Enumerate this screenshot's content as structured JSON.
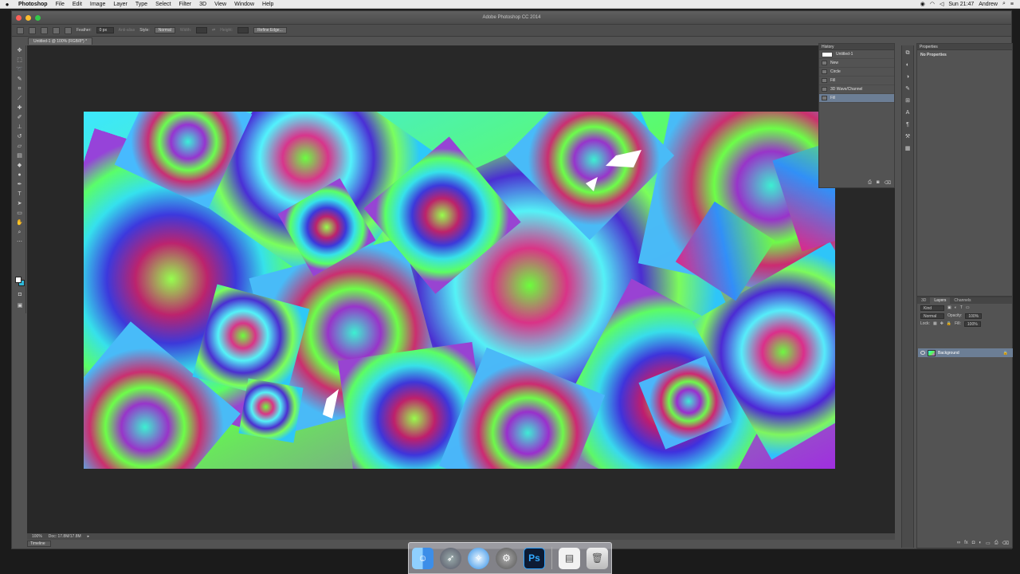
{
  "menubar": {
    "apple": "",
    "app": "Photoshop",
    "items": [
      "File",
      "Edit",
      "Image",
      "Layer",
      "Type",
      "Select",
      "Filter",
      "3D",
      "View",
      "Window",
      "Help"
    ],
    "clock": "Sun 21:47",
    "user": "Andrew"
  },
  "window": {
    "title": "Adobe Photoshop CC 2014",
    "doc_tab": "Untitled-1 @ 100% (RGB/8*) *"
  },
  "options": {
    "feather_label": "Feather:",
    "feather_value": "0 px",
    "antialias": "Anti-alias",
    "style_label": "Style:",
    "style_value": "Normal",
    "width_label": "Width:",
    "height_label": "Height:",
    "refine": "Refine Edge..."
  },
  "status": {
    "zoom": "100%",
    "doc": "Doc: 17.8M/17.8M"
  },
  "timeline_label": "Timeline",
  "history": {
    "title": "History",
    "snapshot": "Untitled-1",
    "items": [
      {
        "label": "New"
      },
      {
        "label": "Circle"
      },
      {
        "label": "Fill"
      },
      {
        "label": "3D Wave/Channel"
      },
      {
        "label": "Fill"
      }
    ]
  },
  "properties": {
    "title": "Properties",
    "empty": "No Properties"
  },
  "layers": {
    "tabs": [
      "3D",
      "Layers",
      "Channels"
    ],
    "kind_label": "Kind",
    "blend": "Normal",
    "opacity_label": "Opacity:",
    "opacity": "100%",
    "lock_label": "Lock:",
    "fill_label": "Fill:",
    "fill": "100%",
    "layer_name": "Background"
  },
  "dock": {
    "apps": [
      "finder-icon",
      "launchpad-icon",
      "safari-icon",
      "system-preferences-icon",
      "photoshop-icon",
      "documents-icon",
      "trash-icon"
    ],
    "ps_label": "Ps"
  },
  "colors": {
    "panel": "#535353",
    "canvas_bg": "#282828",
    "selection": "#6c7e95",
    "fg_swatch": "#ffffff",
    "bg_swatch": "#2fb7d8"
  }
}
